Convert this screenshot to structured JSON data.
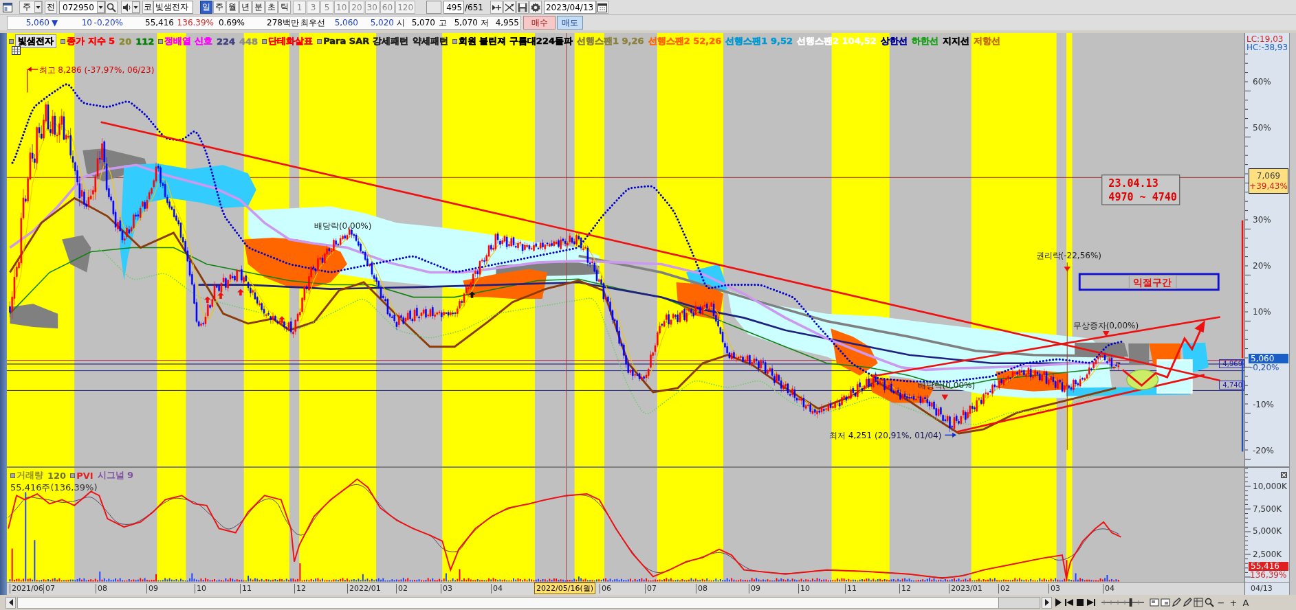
{
  "toolbar": {
    "period_dropdown": "주",
    "all_button": "전",
    "code_field": "072950",
    "market_button": "코",
    "name_field": "빛샘전자",
    "periods": [
      {
        "label": "일",
        "selected": true
      },
      {
        "label": "주",
        "selected": false
      },
      {
        "label": "월",
        "selected": false
      },
      {
        "label": "년",
        "selected": false
      },
      {
        "label": "분",
        "selected": false
      },
      {
        "label": "초",
        "selected": false
      },
      {
        "label": "틱",
        "selected": false
      }
    ],
    "intervals": [
      {
        "label": "1",
        "disabled": true
      },
      {
        "label": "3",
        "disabled": true
      },
      {
        "label": "5",
        "disabled": true
      },
      {
        "label": "10",
        "disabled": true
      },
      {
        "label": "20",
        "disabled": true
      },
      {
        "label": "30",
        "disabled": true
      },
      {
        "label": "60",
        "disabled": true
      },
      {
        "label": "120",
        "disabled": true
      }
    ],
    "count": "495",
    "total": "/651",
    "date_field": "2023/04/13"
  },
  "quote": {
    "price": "5,060",
    "direction": "▼",
    "change": "10",
    "change_rate": "-0.20%",
    "volume": "55,416",
    "volume_rate": "136.39%",
    "turnover_rate": "0.69%",
    "amount": "278백만",
    "best_label": "최우선",
    "ask": "5,060",
    "bid": "5,020",
    "open_label": "시",
    "open": "5,070",
    "high_label": "고",
    "high": "5,070",
    "low_label": "저",
    "low": "4,955",
    "buy_button": "매수",
    "sell_button": "매도"
  },
  "legend": [
    {
      "label": "빛샘전자",
      "kind": "title",
      "marker": true,
      "color": "#000000"
    },
    {
      "label": "종가 지수 5",
      "kind": "series",
      "marker": true,
      "color": "#ff0000"
    },
    {
      "label": "20",
      "kind": "series",
      "marker": false,
      "color": "#8a8a30"
    },
    {
      "label": "112",
      "kind": "series",
      "marker": false,
      "color": "#008000"
    },
    {
      "label": "정배열 신호",
      "kind": "series",
      "marker": true,
      "color": "#ff00ff"
    },
    {
      "label": "224",
      "kind": "series",
      "marker": false,
      "color": "#404080"
    },
    {
      "label": "448",
      "kind": "series",
      "marker": false,
      "color": "#8c8c8c"
    },
    {
      "label": "단테화살표",
      "kind": "series",
      "marker": true,
      "color": "#ff0000"
    },
    {
      "label": "Para SAR 강세패턴",
      "kind": "series",
      "marker": true,
      "color": "#202020"
    },
    {
      "label": "약세패턴",
      "kind": "series",
      "marker": false,
      "color": "#202020"
    },
    {
      "label": "회원 볼린져 구름대224돌파",
      "kind": "series",
      "marker": true,
      "color": "#000000"
    },
    {
      "label": "선행스팬1 9,26",
      "kind": "series",
      "marker": false,
      "color": "#8a8040"
    },
    {
      "label": "선행스팬2 52,26",
      "kind": "series",
      "marker": false,
      "color": "#ff6600"
    },
    {
      "label": "선행스팬1 9,52",
      "kind": "series",
      "marker": false,
      "color": "#0098d0"
    },
    {
      "label": "선행스팬2 104,52",
      "kind": "series",
      "marker": false,
      "color": "#ffffff"
    },
    {
      "label": "상한선",
      "kind": "series",
      "marker": false,
      "color": "#000090"
    },
    {
      "label": "하한선",
      "kind": "series",
      "marker": false,
      "color": "#20a020"
    },
    {
      "label": "지지선",
      "kind": "series",
      "marker": false,
      "color": "#000000"
    },
    {
      "label": "저항선",
      "kind": "series",
      "marker": false,
      "color": "#c87010"
    }
  ],
  "annotations": [
    {
      "kind": "high",
      "text": "최고 8,286 (-37,97%, 06/23)"
    },
    {
      "kind": "event",
      "text": "배당락(0,00%)"
    },
    {
      "kind": "event",
      "text": "권리락(-22,56%)"
    },
    {
      "kind": "event",
      "text": "무상증자(0,00%)"
    },
    {
      "kind": "event",
      "text": "배당락(0,00%)"
    },
    {
      "kind": "low",
      "text": "최저 4,251 (20,91%, 01/04)"
    }
  ],
  "note_box": {
    "date": "23.04.13",
    "range": "4970 ~ 4740"
  },
  "zone_box": {
    "label": "익절구간"
  },
  "level_labels": [
    "4,969",
    "4,740"
  ],
  "price_axis": {
    "lc": "LC:19,03",
    "hc": "HC:-38,93",
    "ticks": [
      "60%",
      "50%",
      "30%",
      "20%",
      "10%",
      "-10%",
      "-20%"
    ],
    "high_marker": {
      "price": "7,069",
      "rate": "+39,43%"
    },
    "current": {
      "price": "5,060",
      "rate": "-0,20%"
    }
  },
  "volume_legend": [
    {
      "label": "거래량",
      "marker": true,
      "color": "#8c8c20"
    },
    {
      "label": "120",
      "marker": false,
      "color": "#707040"
    },
    {
      "label": "PVI",
      "marker": true,
      "color": "#e02020"
    },
    {
      "label": "시그널 9",
      "marker": false,
      "color": "#8050a0"
    }
  ],
  "volume_info": "55,416주(136,39%)",
  "volume_axis": {
    "ticks": [
      "10,000K",
      "7,500K",
      "5,000K",
      "2,500K"
    ],
    "current": "55,416",
    "rate": "136,39%"
  },
  "date_axis": {
    "labels": [
      "2021/06",
      "07",
      "08",
      "09",
      "10",
      "11",
      "12",
      "2022/01",
      "02",
      "03",
      "04",
      "06",
      "07",
      "08",
      "09",
      "10",
      "11",
      "12",
      "2023/01",
      "02",
      "03",
      "04"
    ],
    "cursor": "2022/05/16(월)",
    "last": "04/13"
  },
  "scroll_controls": {
    "zoom_slider": {
      "level": 0.7
    },
    "zoom_labels": [
      "−",
      "+",
      "A"
    ]
  }
}
